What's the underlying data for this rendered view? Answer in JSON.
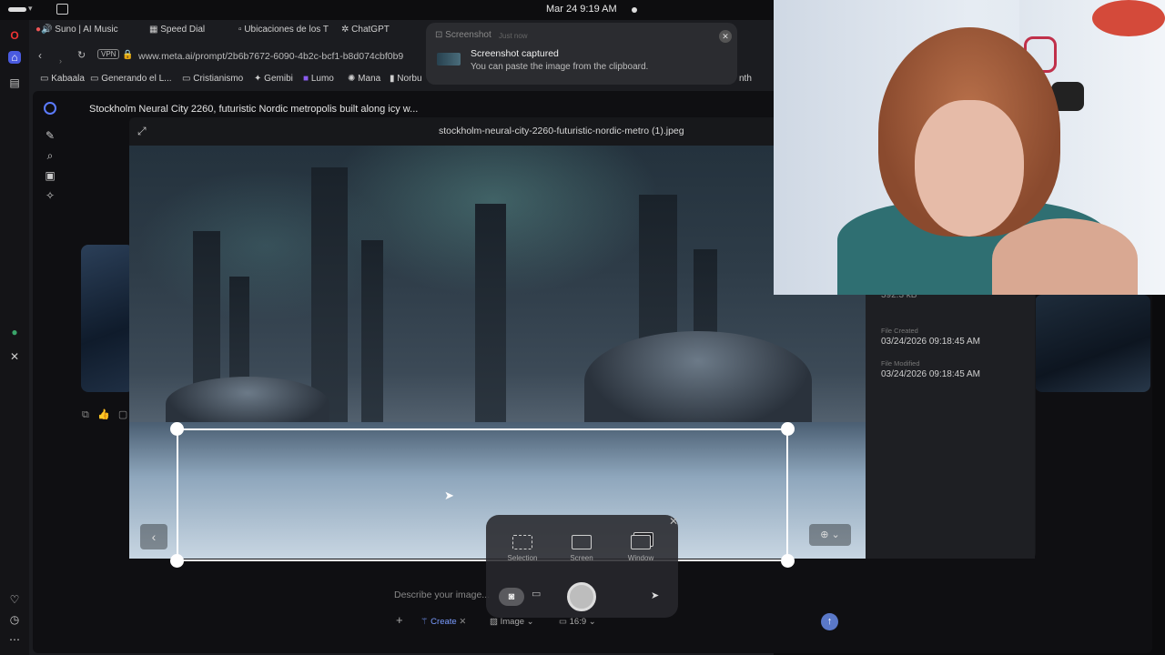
{
  "system": {
    "clock": "Mar 24   9:19 AM"
  },
  "tabs": [
    {
      "label": "Suno | AI Music"
    },
    {
      "label": "Speed Dial"
    },
    {
      "label": "Ubicaciones de los T"
    },
    {
      "label": "ChatGPT"
    }
  ],
  "address": {
    "url": "www.meta.ai/prompt/2b6b7672-6090-4b2c-bcf1-b8d074cbf0b9"
  },
  "bookmarks": [
    {
      "label": "Kabaala"
    },
    {
      "label": "Generando el L..."
    },
    {
      "label": "Cristianismo"
    },
    {
      "label": "Gemibi"
    },
    {
      "label": "Lumo"
    },
    {
      "label": "Mana"
    },
    {
      "label": "Norbu"
    },
    {
      "label": "nth"
    }
  ],
  "prompt": {
    "title": "Stockholm Neural City 2260, futuristic Nordic metropolis built along icy w..."
  },
  "viewer": {
    "filename": "stockholm-neural-city-2260-futuristic-nordic-metro (1).jpeg",
    "info": {
      "size_value": "392.3 kB",
      "created_label": "File Created",
      "created_value": "03/24/2026 09:18:45 AM",
      "modified_label": "File Modified",
      "modified_value": "03/24/2026 09:18:45 AM"
    }
  },
  "composer": {
    "placeholder": "Describe your image...",
    "create_label": "Create",
    "image_label": "Image",
    "ratio_label": "16:9"
  },
  "capture_toolbar": {
    "options": [
      {
        "label": "Selection",
        "icon": "selection-icon"
      },
      {
        "label": "Screen",
        "icon": "screen-icon"
      },
      {
        "label": "Window",
        "icon": "window-icon"
      }
    ]
  },
  "notification": {
    "app": "Screenshot",
    "when": "Just now",
    "title": "Screenshot captured",
    "body": "You can paste the image from the clipboard."
  },
  "colors": {
    "accent": "#5a78c8",
    "background": "#0f0f12",
    "selection": "#ffffff"
  }
}
